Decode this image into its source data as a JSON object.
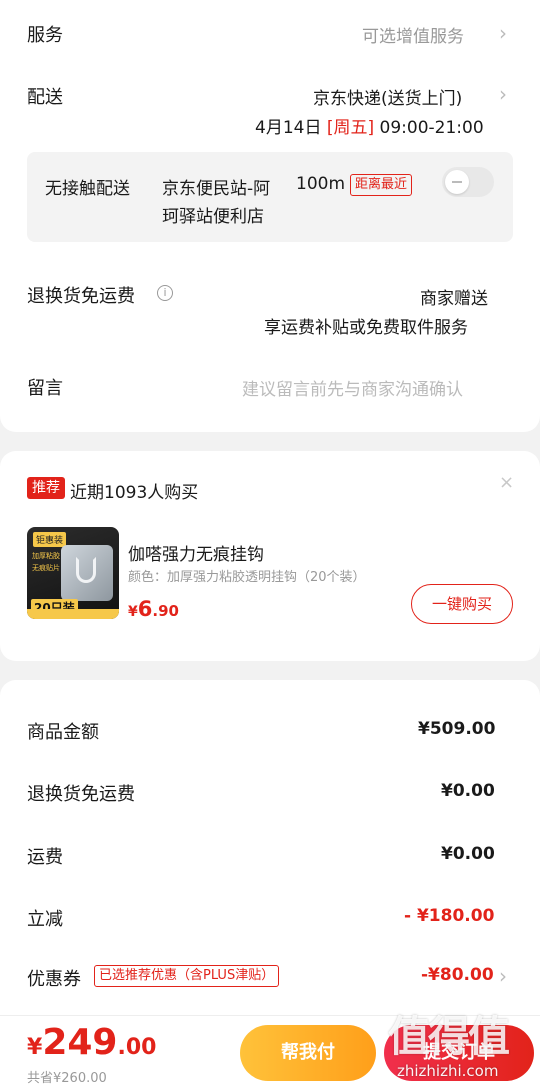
{
  "service": {
    "label": "服务",
    "value": "可选增值服务"
  },
  "delivery": {
    "label": "配送",
    "method": "京东快递(送货上门)",
    "date": "4月14日",
    "weekday": "[周五]",
    "time": "09:00-21:00"
  },
  "contactless": {
    "label": "无接触配送",
    "station_line1": "京东便民站-阿",
    "station_line2": "珂驿站便利店",
    "distance": "100m",
    "distance_tag": "距离最近",
    "enabled": false
  },
  "return_shipping": {
    "label": "退换货免运费",
    "value_line1": "商家赠送",
    "value_line2": "享运费补贴或免费取件服务"
  },
  "message": {
    "label": "留言",
    "placeholder": "建议留言前先与商家沟通确认"
  },
  "recommend": {
    "badge": "推荐",
    "title": "近期1093人购买",
    "close": "×",
    "product": {
      "name": "伽嗒强力无痕挂钩",
      "spec": "颜色：加厚强力粘胶透明挂钩（20个装）",
      "price_symbol": "¥",
      "price_int": "6",
      "price_dec": ".90",
      "buy_label": "一键购买",
      "thumb": {
        "badge": "钜惠装",
        "line1": "加厚粘胶",
        "line2": "无痕贴片",
        "count": "20只装"
      }
    }
  },
  "summary": {
    "rows": [
      {
        "label": "商品金额",
        "value": "¥509.00"
      },
      {
        "label": "退换货免运费",
        "value": "¥0.00"
      },
      {
        "label": "运费",
        "value": "¥0.00"
      },
      {
        "label": "立减",
        "value": "- ¥180.00"
      }
    ],
    "coupon": {
      "label": "优惠券",
      "tag": "已选推荐优惠（含PLUS津贴）",
      "value": "-¥80.00"
    }
  },
  "footer": {
    "total_symbol": "¥",
    "total_int": "249",
    "total_dec": ".00",
    "saved": "共省¥260.00",
    "help_label": "帮我付",
    "submit_label": "提交订单"
  },
  "watermark": {
    "text": "值得值",
    "url": "zhizhizhi.com"
  },
  "colors": {
    "accent": "#e2231a",
    "help_button": "#ffb02e",
    "background": "#f2f2f2"
  }
}
